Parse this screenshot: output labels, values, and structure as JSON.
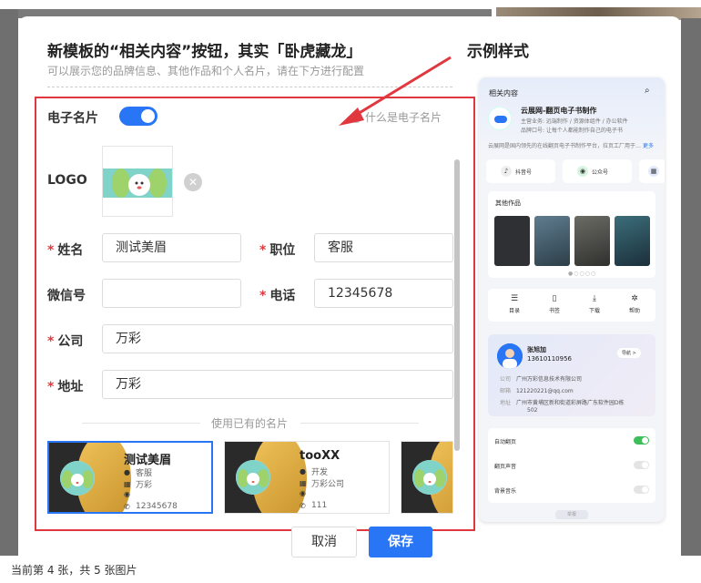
{
  "dialog": {
    "title": "新模板的“相关内容”按钮，其实「卧虎藏龙」",
    "subtitle": "可以展示您的品牌信息、其他作品和个人名片，请在下方进行配置",
    "example_title": "示例样式"
  },
  "form": {
    "ecard_label": "电子名片",
    "ecard_enabled": true,
    "help_text": "什么是电子名片",
    "logo_label": "LOGO",
    "required_mark": "*",
    "name_label": "姓名",
    "name_value": "测试美眉",
    "position_label": "职位",
    "position_value": "客服",
    "wechat_label": "微信号",
    "wechat_value": "",
    "phone_label": "电话",
    "phone_value": "12345678",
    "company_label": "公司",
    "company_value": "万彩",
    "address_label": "地址",
    "address_value": "万彩",
    "existing_cards_label": "使用已有的名片"
  },
  "cards": [
    {
      "name": "测试美眉",
      "position": "客服",
      "company": "万彩",
      "wechat": "",
      "phone": "12345678"
    },
    {
      "name": "tooXX",
      "position": "开发",
      "company": "万彩公司",
      "wechat": "",
      "phone": "111"
    }
  ],
  "actions": {
    "cancel": "取消",
    "save": "保存"
  },
  "footer": "当前第 4 张，共 5 张图片",
  "preview": {
    "header": "相关内容",
    "brand": "云展网-翻页电子书制作",
    "brand_line1": "主营业务: 远端制作 / 资源体组件 / 办公软件",
    "brand_line2": "品牌口号: 让每个人都能制作自己的电子书",
    "brand_desc": "云展网是国内领先的在线翻页电子书制作平台，拉页工厂用于",
    "brand_more": "更多",
    "social": [
      "抖音号",
      "公众号"
    ],
    "works_title": "其他作品",
    "menu": [
      "目录",
      "书签",
      "下载",
      "帮助"
    ],
    "card_name": "张旭加",
    "card_phone": "13610110956",
    "card_nav": "导航 >",
    "company_label": "公司",
    "company": "广州万彩信息技术有限公司",
    "email_label": "邮箱",
    "email": "121220221@qq.com",
    "address_label": "地址",
    "address": "广州市黄埔区新和街道彩屏路广东软件园D栋",
    "address2": "502",
    "settings": [
      {
        "label": "自动翻页",
        "on": true
      },
      {
        "label": "翻页声音",
        "on": false
      },
      {
        "label": "背景音乐",
        "on": false
      }
    ],
    "foot_tag": "举报"
  }
}
